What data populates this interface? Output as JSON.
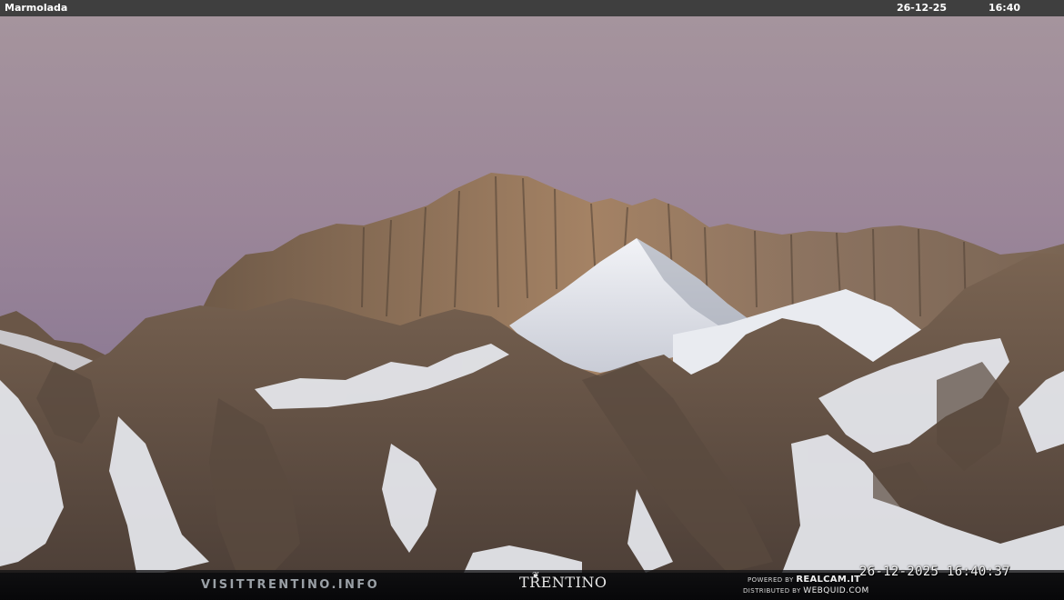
{
  "header": {
    "location": "Marmolada",
    "date": "26-12-25",
    "time": "16:40"
  },
  "footer": {
    "site": "VISITTRENTINO.INFO",
    "logo": "TRENTINO",
    "powered_prefix": "POWERED BY",
    "powered_brand": "REALCAM.IT",
    "distributed_prefix": "DISTRIBUTED BY",
    "distributed_brand": "WEBQUID.COM",
    "timestamp": "26-12-2025 16:40:37"
  },
  "colors": {
    "sky_top": "#a9979f",
    "sky_bottom": "#7b6a8d",
    "rock": "#6b5a48",
    "rock_light": "#9b7f62",
    "snow": "#e6e8ee",
    "bar": "#3f3f3f"
  },
  "scene": "snow-covered dolomite mountain range at dusk"
}
